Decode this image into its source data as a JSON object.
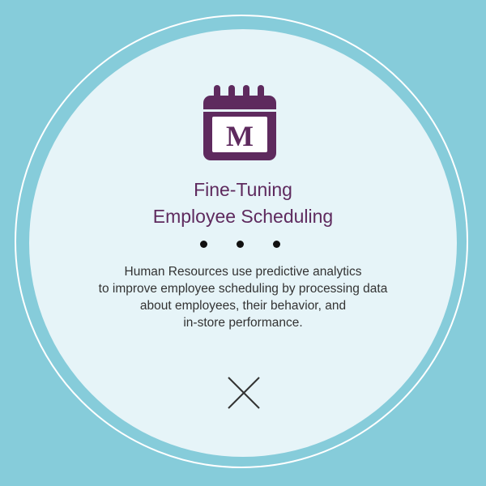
{
  "card": {
    "icon": "calendar-icon",
    "icon_letter": "M",
    "title_line1": "Fine-Tuning",
    "title_line2": "Employee Scheduling",
    "description_lines": [
      "Human Resources use predictive analytics",
      "to improve employee scheduling by processing data",
      "about employees, their behavior, and",
      "in-store performance."
    ],
    "close_icon": "close-icon"
  },
  "colors": {
    "background": "#86CCDA",
    "disc": "#E6F4F8",
    "ring": "#FFFFFF",
    "accent": "#5E2A5E",
    "text": "#333333"
  }
}
